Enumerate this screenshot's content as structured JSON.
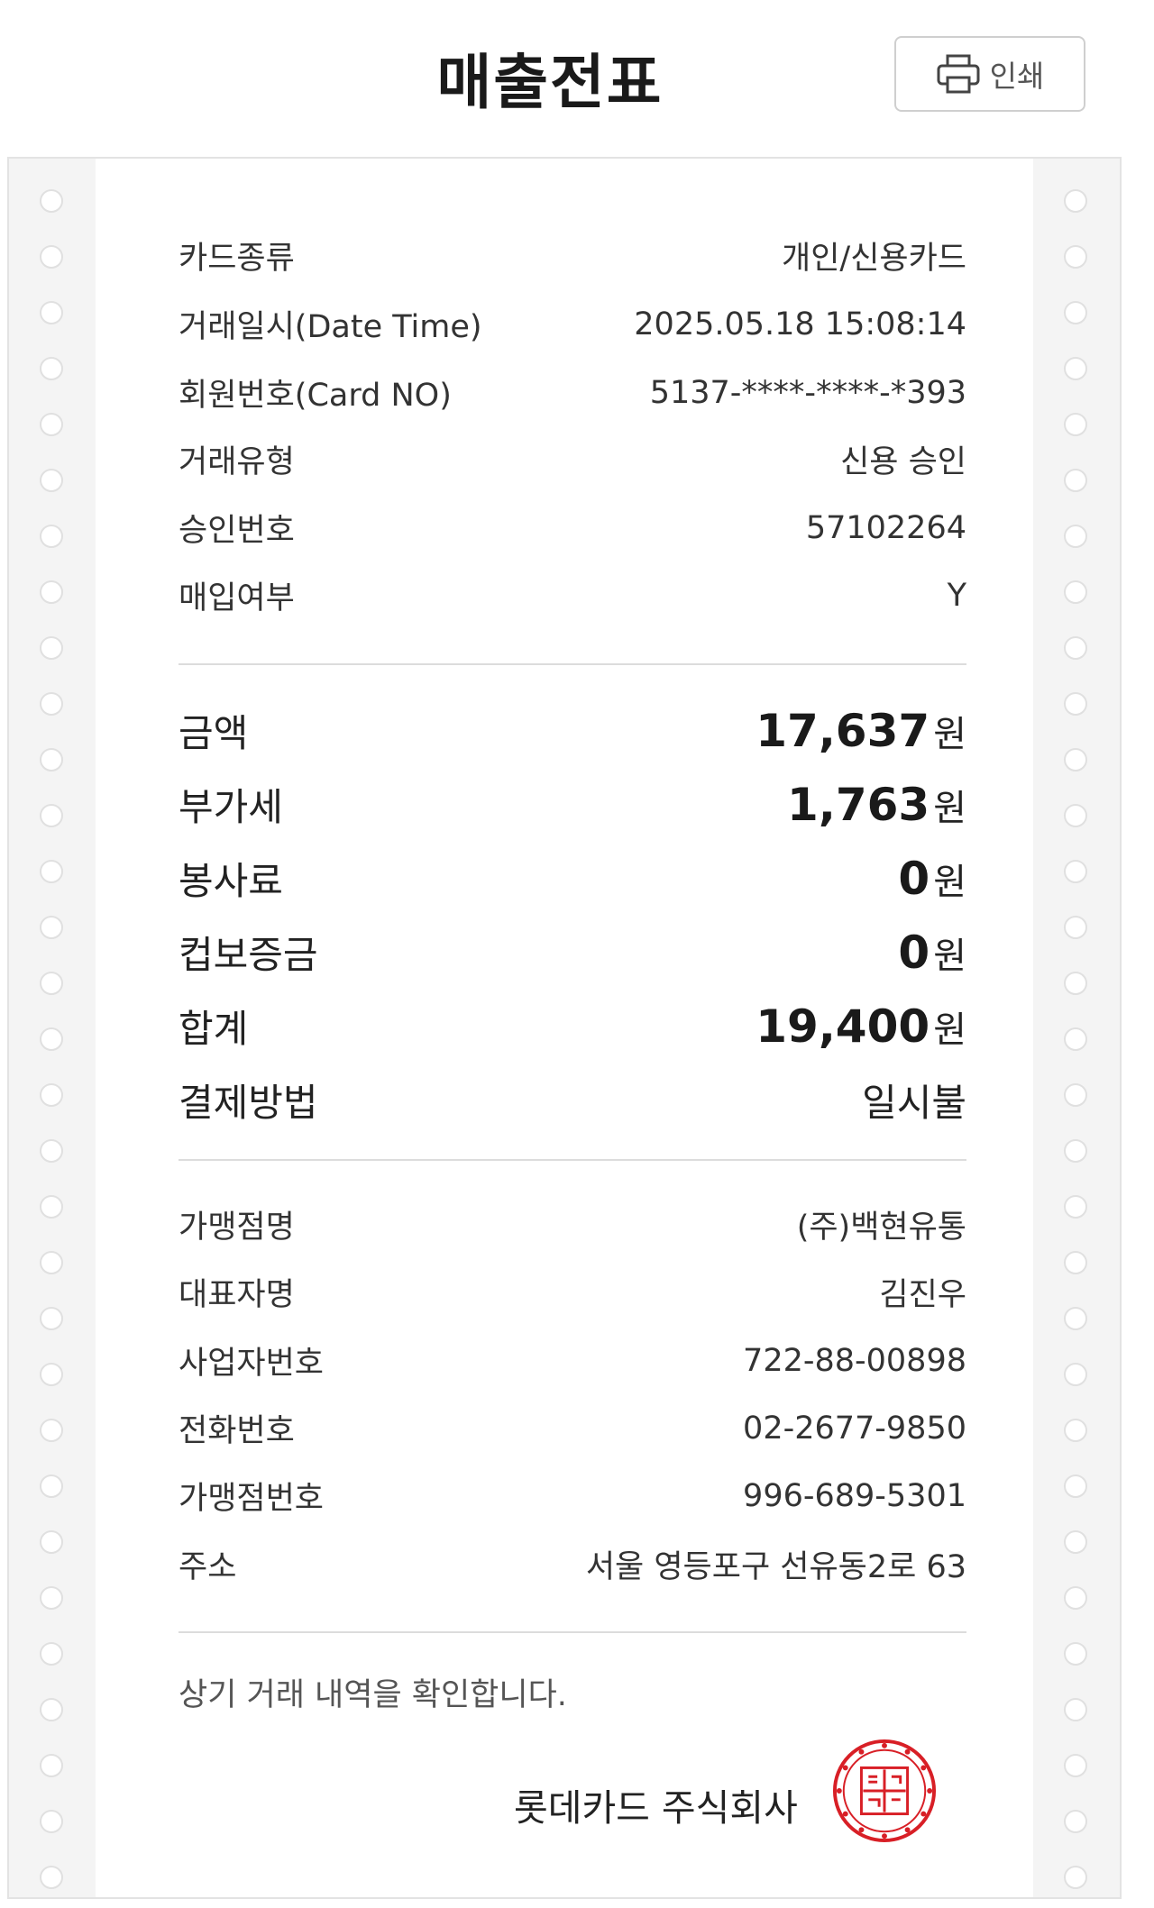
{
  "page": {
    "title": "매출전표",
    "print_button": {
      "label": "인쇄",
      "icon": "printer-icon"
    }
  },
  "card_info": [
    {
      "label": "카드종류",
      "value": "개인/신용카드"
    },
    {
      "label": "거래일시(Date Time)",
      "value": "2025.05.18 15:08:14"
    },
    {
      "label": "회원번호(Card NO)",
      "value": "5137-****-****-*393"
    },
    {
      "label": "거래유형",
      "value": "신용 승인"
    },
    {
      "label": "승인번호",
      "value": "57102264"
    },
    {
      "label": "매입여부",
      "value": "Y"
    }
  ],
  "amounts": [
    {
      "label": "금액",
      "value": "17,637",
      "unit": "원"
    },
    {
      "label": "부가세",
      "value": "1,763",
      "unit": "원"
    },
    {
      "label": "봉사료",
      "value": "0",
      "unit": "원"
    },
    {
      "label": "컵보증금",
      "value": "0",
      "unit": "원"
    },
    {
      "label": "합계",
      "value": "19,400",
      "unit": "원"
    }
  ],
  "payment_method": {
    "label": "결제방법",
    "value": "일시불"
  },
  "merchant": [
    {
      "label": "가맹점명",
      "value": "(주)백현유통"
    },
    {
      "label": "대표자명",
      "value": "김진우"
    },
    {
      "label": "사업자번호",
      "value": "722-88-00898"
    },
    {
      "label": "전화번호",
      "value": "02-2677-9850"
    },
    {
      "label": "가맹점번호",
      "value": "996-689-5301"
    },
    {
      "label": "주소",
      "value": "서울 영등포구 선유동2로 63"
    }
  ],
  "footer": {
    "confirmation": "상기 거래 내역을 확인합니다.",
    "company": "롯데카드 주식회사",
    "seal": {
      "text": "롯데카드",
      "color": "#d81f26"
    }
  },
  "colors": {
    "seal_red": "#d81f26",
    "divider": "#dcdcdc",
    "margin_strip": "#f4f4f4"
  }
}
